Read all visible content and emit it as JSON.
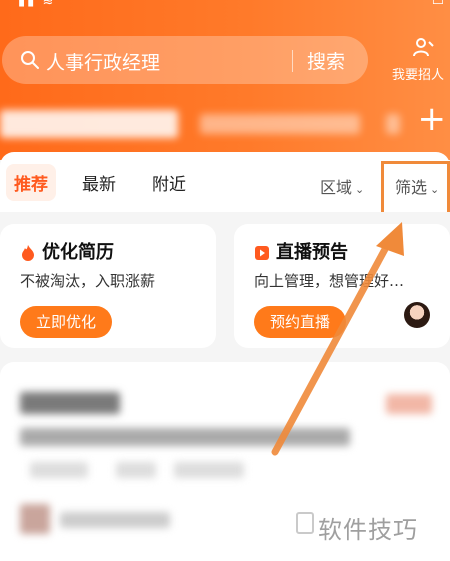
{
  "search": {
    "query": "人事行政经理",
    "button_label": "搜索"
  },
  "header": {
    "recruit_label": "我要招人"
  },
  "filter_bar": {
    "tabs": [
      {
        "label": "推荐",
        "active": true
      },
      {
        "label": "最新",
        "active": false
      },
      {
        "label": "附近",
        "active": false
      }
    ],
    "region_label": "区域",
    "filter_label": "筛选"
  },
  "cards": [
    {
      "title": "优化简历",
      "subtitle": "不被淘汰，入职涨薪",
      "button": "立即优化",
      "icon": "fire-icon"
    },
    {
      "title": "直播预告",
      "subtitle": "向上管理，想管理好…",
      "button": "预约直播",
      "icon": "live-play-icon"
    }
  ],
  "watermark": "软件技巧",
  "colors": {
    "brand": "#ff6a1a",
    "highlight": "#f08a3a",
    "active_tab_bg": "#fff0e8"
  }
}
